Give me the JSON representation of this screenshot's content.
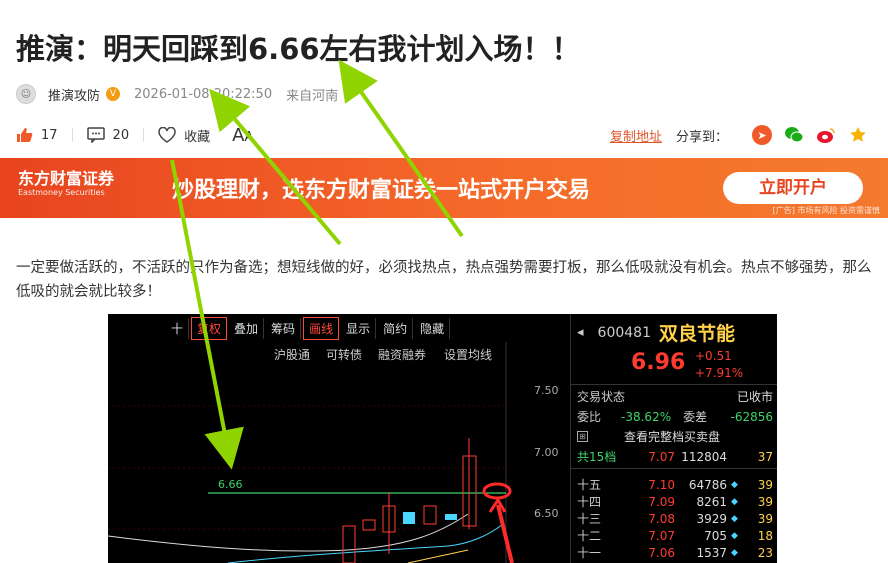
{
  "article": {
    "title": "推演：明天回踩到6.66左右我计划入场！！",
    "author": "推演攻防",
    "verified_badge": "V",
    "date": "2026-01-08 20:22:50",
    "location": "来自河南",
    "likes": "17",
    "comments": "20",
    "favorite": "收藏",
    "font_toggle_big": "A",
    "font_toggle_small": "A",
    "copy_link": "复制地址",
    "share_label": "分享到：",
    "paragraph": "一定要做活跃的，不活跃的只作为备选；想短线做的好，必须找热点，热点强势需要打板，那么低吸就没有机会。热点不够强势，那么低吸的就会就比较多！"
  },
  "banner": {
    "logo_cn": "东方财富证券",
    "logo_en": "Eastmoney Securities",
    "slogan": "炒股理财，选东方财富证券一站式开户交易",
    "button": "立即开户",
    "note": "[广告] 市场有风险 投资需谨慎"
  },
  "chart": {
    "toolbar": [
      "十",
      "复权",
      "叠加",
      "筹码",
      "画线",
      "显示",
      "简约",
      "隐藏"
    ],
    "subbar": [
      "沪股通",
      "可转债",
      "融资融券",
      "设置均线"
    ],
    "axis": [
      "7.50",
      "7.00",
      "6.50"
    ],
    "hline_label": "6.66",
    "colors": {
      "up": "#ff3b30",
      "down": "#4ad6ff",
      "line": "#3ed36a",
      "ma": "#ffffff"
    }
  },
  "quote": {
    "code": "600481",
    "name": "双良节能",
    "price": "6.96",
    "change": "+0.51",
    "change_pct": "+7.91%",
    "status_label": "交易状态",
    "status": "已收市",
    "weibi_label": "委比",
    "weibi": "-38.62%",
    "weicha_label": "委差",
    "weicha": "-62856",
    "full_book": "查看完整档买卖盘",
    "total_label": "共15档",
    "total_price": "7.07",
    "total_vol": "112804",
    "total_cnt": "37",
    "rows": [
      {
        "label": "十五",
        "price": "7.10",
        "vol": "64786",
        "cnt": "39"
      },
      {
        "label": "十四",
        "price": "7.09",
        "vol": "8261",
        "cnt": "39"
      },
      {
        "label": "十三",
        "price": "7.08",
        "vol": "3929",
        "cnt": "39"
      },
      {
        "label": "十二",
        "price": "7.07",
        "vol": "705",
        "cnt": "18"
      },
      {
        "label": "十一",
        "price": "7.06",
        "vol": "1537",
        "cnt": "23"
      }
    ]
  }
}
